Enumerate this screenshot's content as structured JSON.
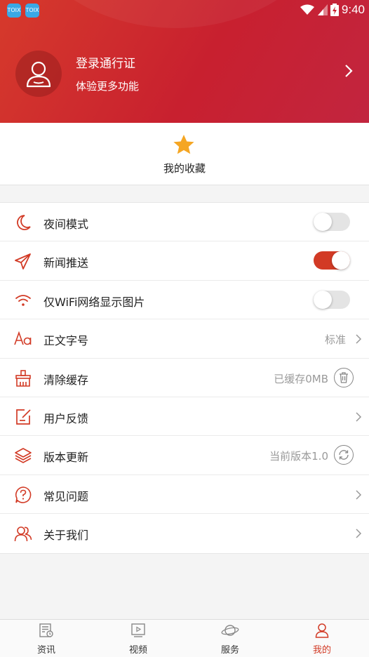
{
  "status_bar": {
    "time": "9:40",
    "app_icon_label": "TOIX"
  },
  "profile": {
    "title": "登录通行证",
    "subtitle": "体验更多功能"
  },
  "favorites": {
    "label": "我的收藏"
  },
  "settings": [
    {
      "id": "night",
      "label": "夜间模式",
      "icon": "moon-icon",
      "control": "toggle",
      "on": false
    },
    {
      "id": "push",
      "label": "新闻推送",
      "icon": "send-icon",
      "control": "toggle",
      "on": true
    },
    {
      "id": "wifi",
      "label": "仅WiFi网络显示图片",
      "icon": "wifi-icon",
      "control": "toggle",
      "on": false
    },
    {
      "id": "font",
      "label": "正文字号",
      "icon": "font-size-icon",
      "control": "chevron",
      "value": "标准"
    },
    {
      "id": "cache",
      "label": "清除缓存",
      "icon": "broom-icon",
      "control": "button",
      "value": "已缓存0MB",
      "button_icon": "trash-icon"
    },
    {
      "id": "feedback",
      "label": "用户反馈",
      "icon": "edit-icon",
      "control": "chevron"
    },
    {
      "id": "update",
      "label": "版本更新",
      "icon": "layers-icon",
      "control": "button",
      "value": "当前版本1.0",
      "button_icon": "refresh-icon"
    },
    {
      "id": "faq",
      "label": "常见问题",
      "icon": "question-icon",
      "control": "chevron"
    },
    {
      "id": "about",
      "label": "关于我们",
      "icon": "users-icon",
      "control": "chevron"
    }
  ],
  "tabs": [
    {
      "label": "资讯",
      "icon": "news-icon",
      "active": false
    },
    {
      "label": "视频",
      "icon": "video-icon",
      "active": false
    },
    {
      "label": "服务",
      "icon": "planet-icon",
      "active": false
    },
    {
      "label": "我的",
      "icon": "user-icon",
      "active": true
    }
  ],
  "colors": {
    "accent": "#d23a25",
    "header_start": "#d63a2c",
    "header_end": "#c2253f",
    "star": "#f5a623"
  }
}
